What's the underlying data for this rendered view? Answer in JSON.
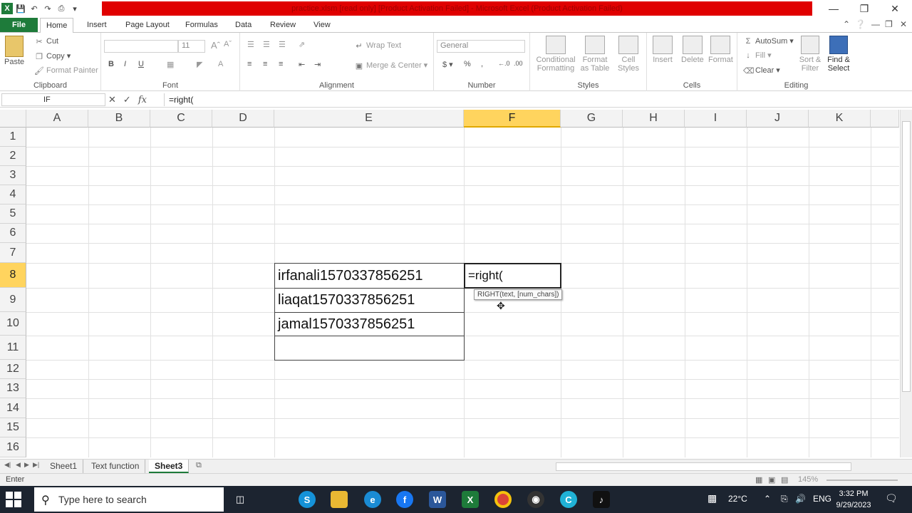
{
  "window": {
    "title": "practice.xlsm [read only] [Product Activation Failed] - Microsoft Excel (Product Activation Failed)"
  },
  "tabs": [
    "File",
    "Home",
    "Insert",
    "Page Layout",
    "Formulas",
    "Data",
    "Review",
    "View"
  ],
  "ribbon": {
    "clipboard": {
      "label": "Clipboard",
      "paste": "Paste",
      "cut": "Cut",
      "copy": "Copy",
      "format_painter": "Format Painter"
    },
    "font": {
      "label": "Font",
      "size": "11"
    },
    "alignment": {
      "label": "Alignment",
      "wrap": "Wrap Text",
      "merge": "Merge & Center"
    },
    "number": {
      "label": "Number",
      "format": "General"
    },
    "styles": {
      "label": "Styles",
      "conditional": "Conditional Formatting",
      "format_table": "Format as Table",
      "cell_styles": "Cell Styles"
    },
    "cells": {
      "label": "Cells",
      "insert": "Insert",
      "delete": "Delete",
      "format": "Format"
    },
    "editing": {
      "label": "Editing",
      "autosum": "AutoSum",
      "fill": "Fill",
      "clear": "Clear",
      "sort": "Sort & Filter",
      "find": "Find & Select"
    }
  },
  "formula_bar": {
    "name_box": "IF",
    "formula": "=right("
  },
  "columns": [
    "A",
    "B",
    "C",
    "D",
    "E",
    "F",
    "G",
    "H",
    "I",
    "J",
    "K"
  ],
  "rows": [
    "1",
    "2",
    "3",
    "4",
    "5",
    "6",
    "7",
    "8",
    "9",
    "10",
    "11",
    "12",
    "13",
    "14",
    "15",
    "16"
  ],
  "cells": {
    "E8": "irfanali1570337856251",
    "E9": "liaqat1570337856251",
    "E10": "jamal1570337856251",
    "F8": "=right("
  },
  "tooltip": "RIGHT(text, [num_chars])",
  "sheets": [
    "Sheet1",
    "Text function",
    "Sheet3"
  ],
  "active_sheet": "Sheet3",
  "status": {
    "mode": "Enter",
    "zoom": "145%"
  },
  "taskbar": {
    "search_placeholder": "Type here to search",
    "weather": "22°C",
    "lang": "ENG",
    "time": "3:32 PM",
    "date": "9/29/2023"
  }
}
